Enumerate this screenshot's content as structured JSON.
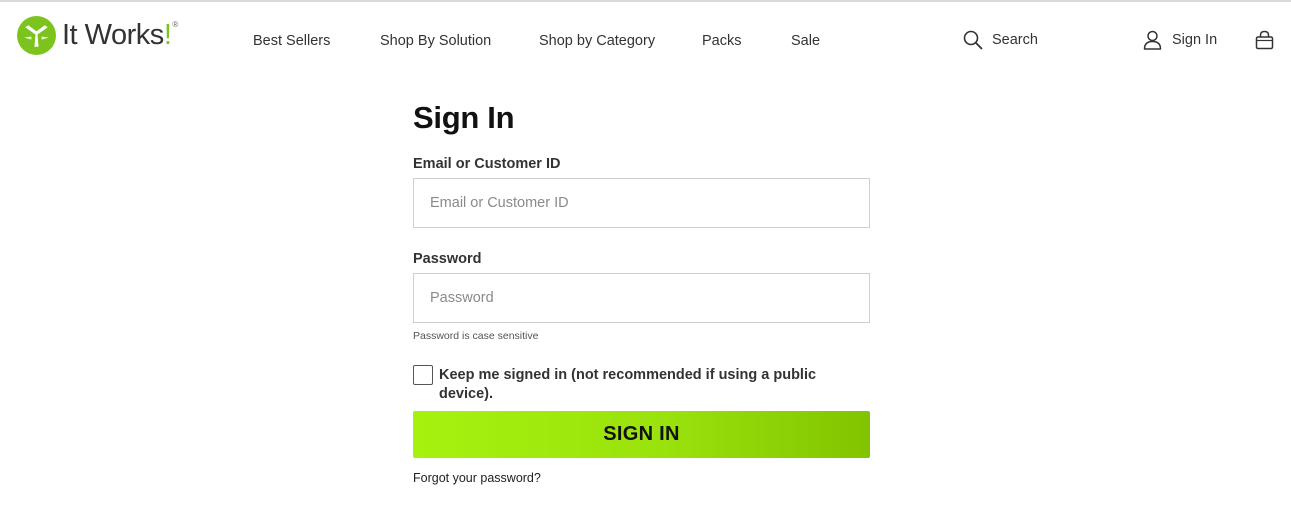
{
  "brand": {
    "name": "It Works",
    "exclamation": "!",
    "trademark": "®",
    "logo_icon": "it-works-logo-icon",
    "accent_color": "#7cc31e"
  },
  "nav": {
    "items": [
      {
        "label": "Best Sellers"
      },
      {
        "label": "Shop By Solution"
      },
      {
        "label": "Shop by Category"
      },
      {
        "label": "Packs"
      },
      {
        "label": "Sale"
      }
    ]
  },
  "header": {
    "search_label": "Search",
    "search_icon": "search-icon",
    "signin_label": "Sign In",
    "user_icon": "user-icon",
    "bag_icon": "shopping-bag-icon"
  },
  "form": {
    "title": "Sign In",
    "email_label": "Email or Customer ID",
    "email_placeholder": "Email or Customer ID",
    "email_value": "",
    "password_label": "Password",
    "password_placeholder": "Password",
    "password_value": "",
    "password_hint": "Password is case sensitive",
    "keep_signed_in_label": "Keep me signed in (not recommended if using a public device).",
    "keep_signed_in_checked": false,
    "submit_label": "SIGN IN",
    "submit_gradient": [
      "#a6f20e",
      "#82c400"
    ],
    "forgot_label": "Forgot your password?"
  }
}
